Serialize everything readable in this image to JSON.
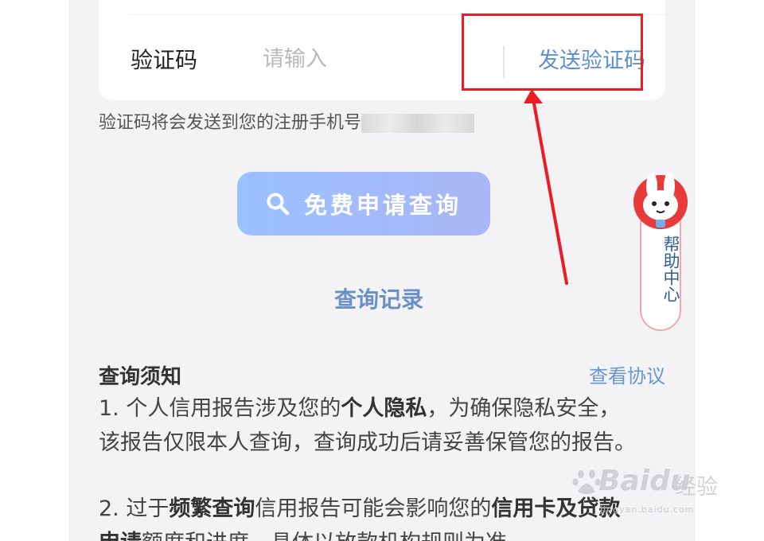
{
  "verification": {
    "label": "验证码",
    "placeholder": "请输入",
    "send_button": "发送验证码",
    "hint": "验证码将会发送到您的注册手机号"
  },
  "query_button": {
    "label": "免费申请查询",
    "icon": "search-icon"
  },
  "records_link": "查询记录",
  "notice": {
    "title": "查询须知",
    "agreement_link": "查看协议",
    "item1": {
      "pre": "1. 个人信用报告涉及您的",
      "bold": "个人隐私",
      "post": "，为确保隐私安全，该报告仅限本人查询，查询成功后请妥善保管您的报告。"
    },
    "item2": {
      "pre": "2. 过于",
      "bold1": "频繁查询",
      "mid": "信用报告可能会影响您的",
      "bold2": "信用卡及贷款申请",
      "post": "额度和进度，具体以放款机构规则为准。"
    }
  },
  "help_center": {
    "label": "帮助中心",
    "icon": "bunny-mascot-icon"
  },
  "watermark": {
    "brand": "Baidu",
    "cn": "经验",
    "sub": "jingyan.baidu.com"
  },
  "colors": {
    "accent": "#6a91c6",
    "annotation": "#ec1c24",
    "button_start": "#9bc1ff",
    "button_end": "#a9b6f7"
  }
}
